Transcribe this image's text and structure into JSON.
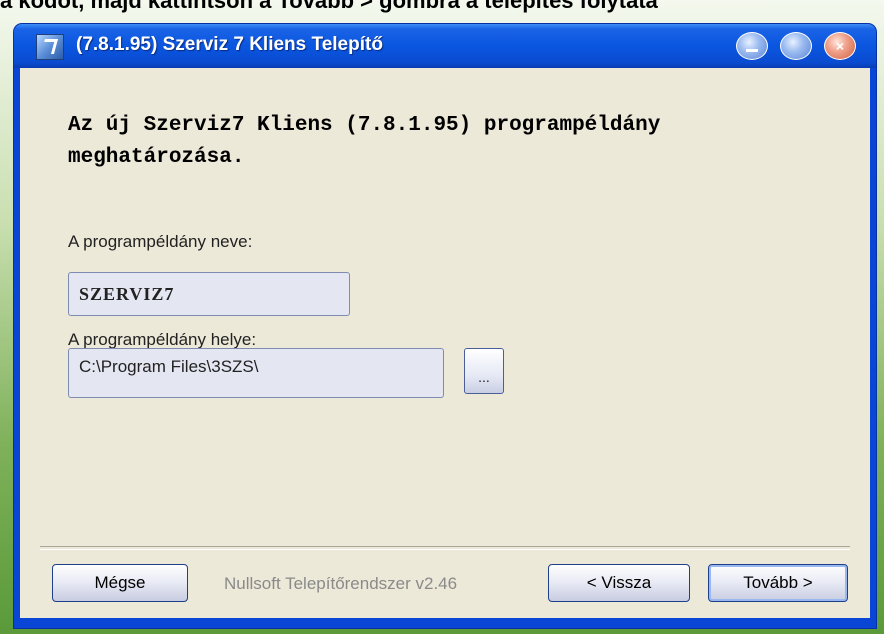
{
  "page_caption": "a kódot, majd kattintson a Tovább > gombra a telepítés folytatá",
  "window": {
    "title": "(7.8.1.95) Szerviz 7 Kliens Telepítő",
    "app_icon": "installer-app-icon",
    "controls": {
      "minimize_icon": "minimize-icon",
      "maximize_icon": "maximize-icon",
      "close_icon": "close-icon",
      "close_glyph": "×"
    }
  },
  "content": {
    "headline": "Az új Szerviz7 Kliens (7.8.1.95) programpéldány meghatározása.",
    "instance_name_label": "A programpéldány neve:",
    "instance_name_value": "SZERVIZ7",
    "instance_path_label": "A programpéldány helye:",
    "instance_path_value": "C:\\Program Files\\3SZS\\",
    "browse_label": "..."
  },
  "footer": {
    "cancel_label": "Mégse",
    "branding": "Nullsoft Telepítőrendszer v2.46",
    "back_label": "< Vissza",
    "next_label": "Tovább >"
  },
  "colors": {
    "titlebar": "#0b56e0",
    "dialog_bg": "#ece9d8",
    "field_bg": "#e4e7f2"
  }
}
